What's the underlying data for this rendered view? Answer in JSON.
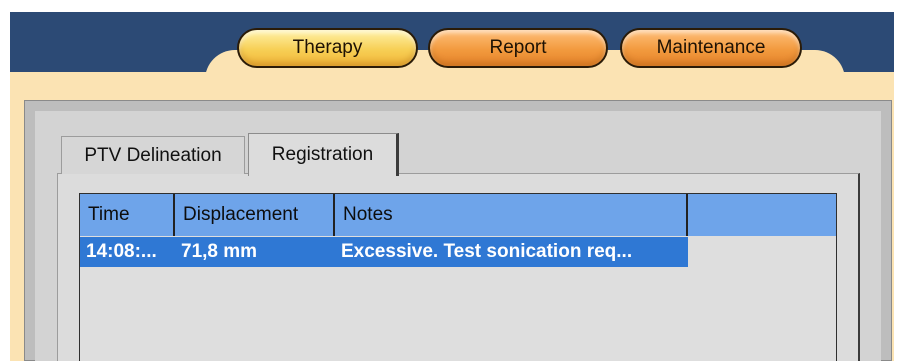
{
  "main_tabs": [
    {
      "label": "Therapy",
      "active": true
    },
    {
      "label": "Report",
      "active": false
    },
    {
      "label": "Maintenance",
      "active": false
    }
  ],
  "sub_tabs": [
    {
      "label": "PTV Delineation",
      "active": false
    },
    {
      "label": "Registration",
      "active": true
    }
  ],
  "table": {
    "columns": [
      "Time",
      "Displacement",
      "Notes"
    ],
    "rows": [
      {
        "time": "14:08:...",
        "displacement": "71,8 mm",
        "notes": "Excessive. Test sonication req...",
        "selected": true
      }
    ]
  },
  "colors": {
    "header_band": "#2c4a75",
    "frame": "#fbe3b3",
    "active_tab": "#f7cf55",
    "inactive_tab": "#f29a3e",
    "table_header": "#6ea4ea",
    "selected_row": "#2f78d4"
  }
}
